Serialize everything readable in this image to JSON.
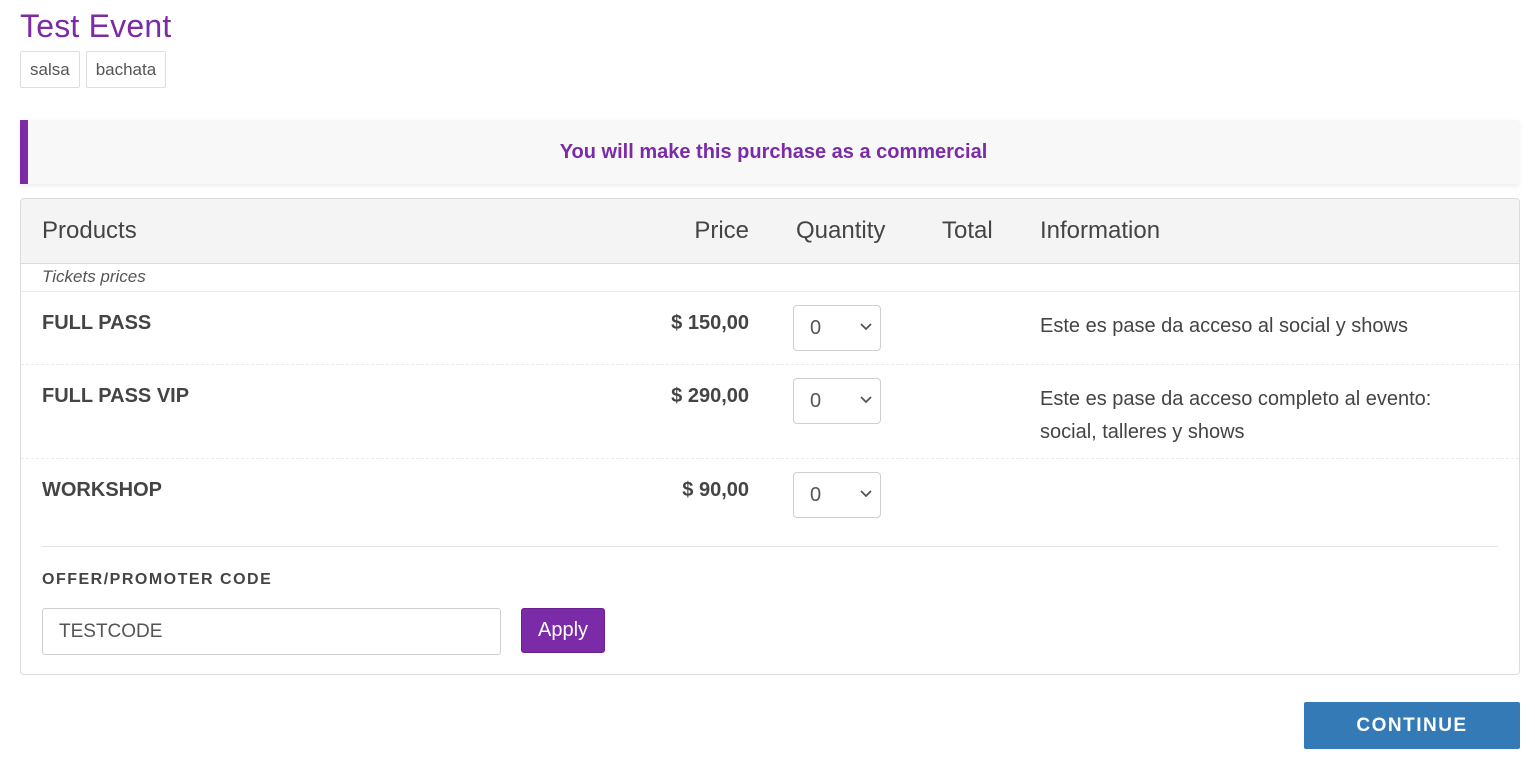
{
  "event": {
    "title": "Test Event",
    "tags": [
      "salsa",
      "bachata"
    ]
  },
  "notice": {
    "text": "You will make this purchase as a commercial",
    "accent_color": "#7b2aa8"
  },
  "products_table": {
    "headers": {
      "products": "Products",
      "price": "Price",
      "quantity": "Quantity",
      "total": "Total",
      "information": "Information"
    },
    "section_label": "Tickets prices",
    "rows": [
      {
        "name": "FULL PASS",
        "price": "$ 150,00",
        "quantity": "0",
        "total": "",
        "information": "Este es pase da acceso al social y shows"
      },
      {
        "name": "FULL PASS VIP",
        "price": "$ 290,00",
        "quantity": "0",
        "total": "",
        "information": "Este es pase da acceso completo al evento: social, talleres y shows"
      },
      {
        "name": "WORKSHOP",
        "price": "$ 90,00",
        "quantity": "0",
        "total": "",
        "information": ""
      }
    ]
  },
  "offer": {
    "label": "OFFER/PROMOTER CODE",
    "value": "TESTCODE",
    "apply_label": "Apply"
  },
  "actions": {
    "continue_label": "CONTINUE",
    "continue_color": "#337ab7"
  },
  "icons": {
    "quantity_select": "chevron-down-icon"
  }
}
